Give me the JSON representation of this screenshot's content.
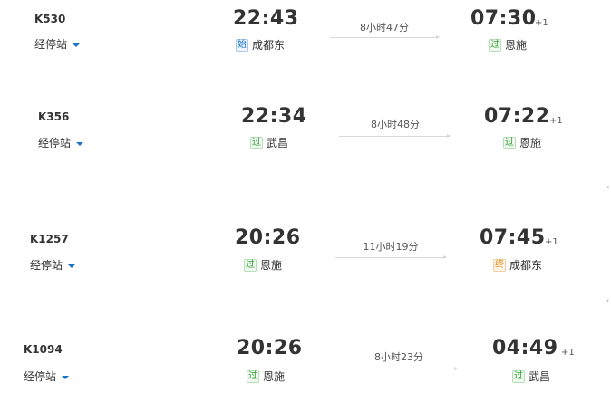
{
  "trains": [
    {
      "number": "K530",
      "stops_label": "经停站",
      "depart_time": "22:43",
      "depart_badge": "始",
      "depart_badge_type": "start",
      "depart_station": "成都东",
      "duration": "8小时47分",
      "arrive_time": "07:30",
      "arrive_day_offset": "+1",
      "arrive_badge": "过",
      "arrive_badge_type": "pass",
      "arrive_station": "恩施"
    },
    {
      "number": "K356",
      "stops_label": "经停站",
      "depart_time": "22:34",
      "depart_badge": "过",
      "depart_badge_type": "pass",
      "depart_station": "武昌",
      "duration": "8小时48分",
      "arrive_time": "07:22",
      "arrive_day_offset": "+1",
      "arrive_badge": "过",
      "arrive_badge_type": "pass",
      "arrive_station": "恩施"
    },
    {
      "number": "K1257",
      "stops_label": "经停站",
      "depart_time": "20:26",
      "depart_badge": "过",
      "depart_badge_type": "pass",
      "depart_station": "恩施",
      "duration": "11小时19分",
      "arrive_time": "07:45",
      "arrive_day_offset": "+1",
      "arrive_badge": "终",
      "arrive_badge_type": "end",
      "arrive_station": "成都东"
    },
    {
      "number": "K1094",
      "stops_label": "经停站",
      "depart_time": "20:26",
      "depart_badge": "过",
      "depart_badge_type": "pass",
      "depart_station": "恩施",
      "duration": "8小时23分",
      "arrive_time": "04:49",
      "arrive_day_offset": "+1",
      "arrive_badge": "过",
      "arrive_badge_type": "pass",
      "arrive_station": "武昌"
    }
  ],
  "colors": {
    "link_caret": "#1a73c9",
    "badge_start": "#1a73c9",
    "badge_pass": "#2f9e2f",
    "badge_end": "#e08a1e"
  }
}
